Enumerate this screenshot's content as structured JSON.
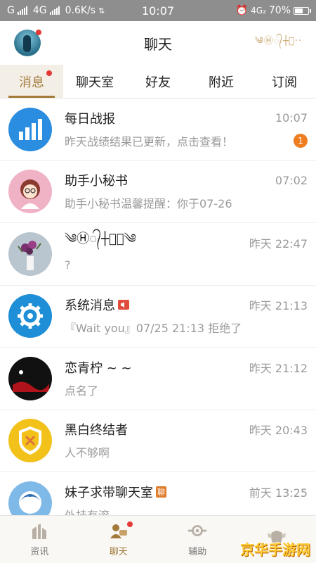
{
  "status_bar": {
    "carrier1": "G",
    "carrier2": "4G",
    "speed": "0.6K/s",
    "time": "10:07",
    "network": "4G₂",
    "battery": "70%",
    "battery_level": 0.7
  },
  "header": {
    "title": "聊天",
    "decoration": "༄Ⓗ᭄┼᭄··"
  },
  "tabs": [
    {
      "label": "消息",
      "active": true,
      "has_dot": true
    },
    {
      "label": "聊天室",
      "active": false,
      "has_dot": false
    },
    {
      "label": "好友",
      "active": false,
      "has_dot": false
    },
    {
      "label": "附近",
      "active": false,
      "has_dot": false
    },
    {
      "label": "订阅",
      "active": false,
      "has_dot": false
    }
  ],
  "chats": [
    {
      "name": "每日战报",
      "time": "10:07",
      "preview": "昨天战绩结果已更新，点击查看！",
      "badge": "1",
      "icon": "bar-chart-icon",
      "icon_bg": "#2a8de0"
    },
    {
      "name": "助手小秘书",
      "time": "07:02",
      "preview": "助手小秘书温馨提醒：你于07-26",
      "badge": "",
      "icon": "assistant-girl-icon",
      "icon_bg": "#f0b3c5"
    },
    {
      "name": "༄Ⓗ᭄┼᭄㊅༄",
      "time": "昨天  22:47",
      "preview": "?",
      "badge": "",
      "icon": "flower-vase-avatar",
      "icon_bg": "#b9c6cf"
    },
    {
      "name": "系统消息",
      "time": "昨天  21:13",
      "preview": "『Wait you』07/25 21:13  拒绝了",
      "badge": "",
      "icon": "gear-icon",
      "icon_bg": "#1e8fd6",
      "speaker": true
    },
    {
      "name": "恋青柠 ~ ~",
      "time": "昨天  21:12",
      "preview": "点名了",
      "badge": "",
      "icon": "dark-avatar",
      "icon_bg": "#111111"
    },
    {
      "name": "黑白终结者",
      "time": "昨天  20:43",
      "preview": "人不够啊",
      "badge": "",
      "icon": "shield-icon",
      "icon_bg": "#f2c21b"
    },
    {
      "name": "妹子求带聊天室",
      "time": "前天  13:25",
      "preview": "外挂有滚",
      "badge": "",
      "icon": "girl-avatar",
      "icon_bg": "#7fb9e8",
      "tag": "聊"
    }
  ],
  "bottom_nav": [
    {
      "label": "资讯",
      "active": false,
      "icon": "news-icon"
    },
    {
      "label": "聊天",
      "active": true,
      "icon": "chat-icon",
      "has_dot": true
    },
    {
      "label": "辅助",
      "active": false,
      "icon": "assist-icon"
    },
    {
      "label": "",
      "active": false,
      "icon": "shield-wings-icon"
    }
  ],
  "watermark": "京华手游网",
  "colors": {
    "accent": "#a37a3a",
    "badge": "#ef7d21",
    "dot": "#e53935"
  }
}
